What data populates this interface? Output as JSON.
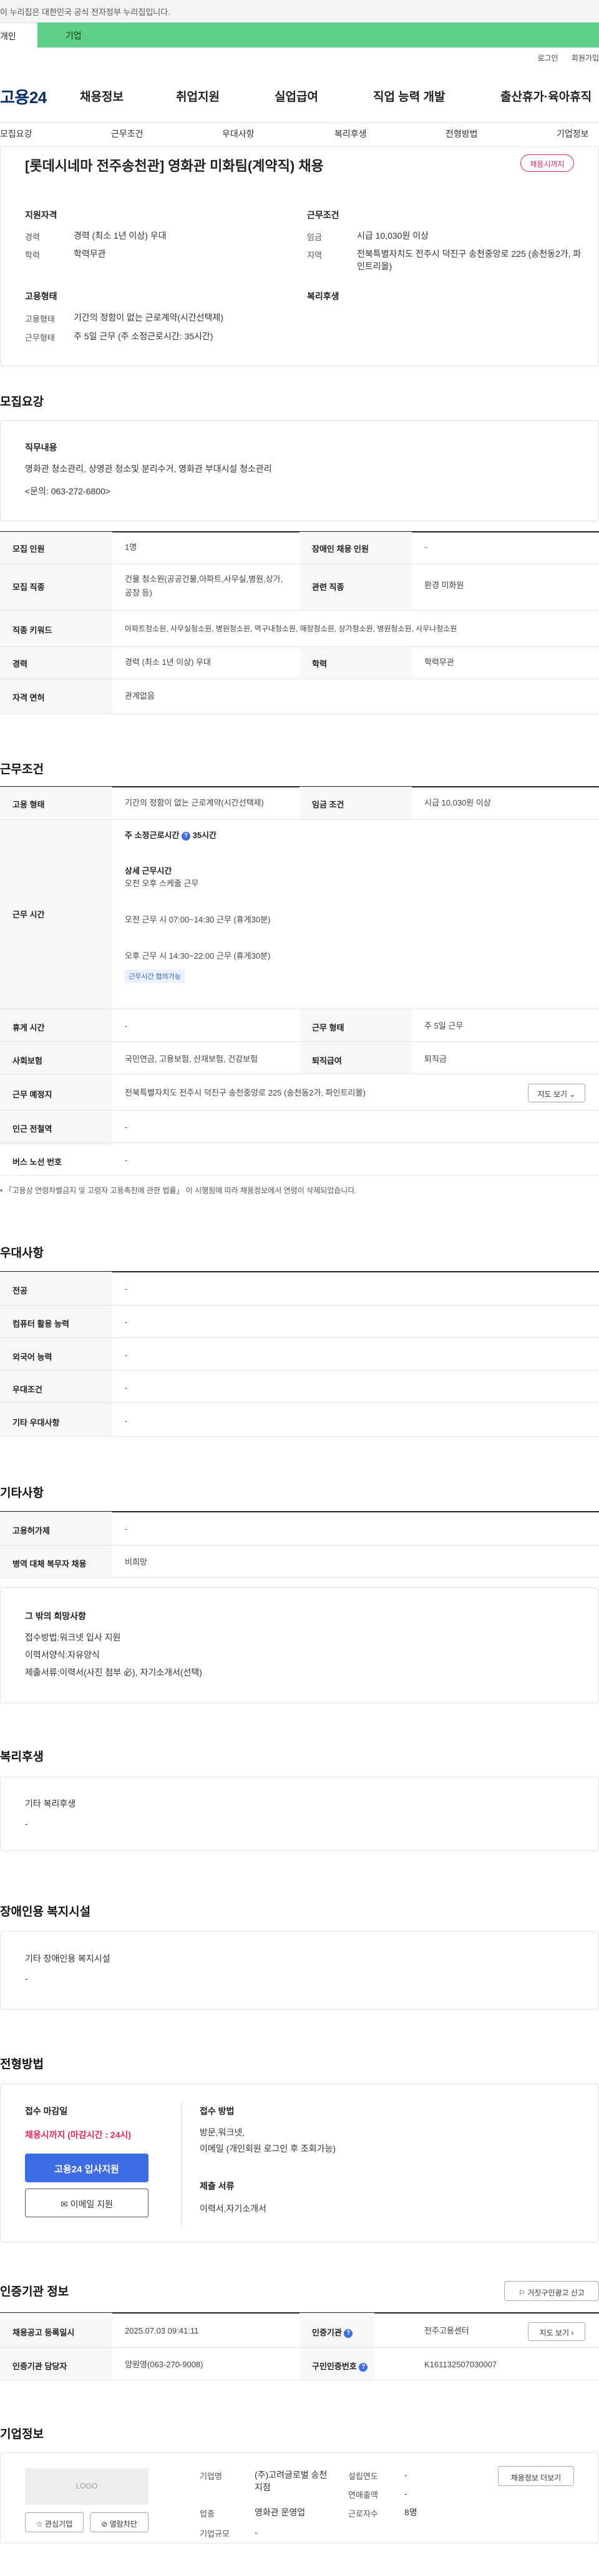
{
  "gov_banner": "이 누리집은 대한민국 공식 전자정부 누리집입니다.",
  "user_tabs": {
    "personal": "개인",
    "company": "기업"
  },
  "utility": {
    "login": "로그인",
    "signup": "회원가입"
  },
  "brand": "고용24",
  "main_nav": [
    "채용정보",
    "취업지원",
    "실업급여",
    "직업 능력 개발",
    "출산휴가·육아휴직"
  ],
  "sub_nav": [
    "모집요강",
    "근무조건",
    "우대사항",
    "복리후생",
    "전형방법",
    "기업정보"
  ],
  "job": {
    "title": "[롯데시네마 전주송천관] 영화관 미화팀(계약직) 채용",
    "badge": "채용시까지",
    "qual_heading": "지원자격",
    "career_label": "경력",
    "career_value": "경력 (최소 1년 이상) 우대",
    "edu_label": "학력",
    "edu_value": "학력무관",
    "work_cond_heading": "근무조건",
    "wage_label": "임금",
    "wage_value": "시급 10,030원 이상",
    "region_label": "지역",
    "region_value": "전북특별자치도 전주시 덕진구 송천중앙로 225 (송천동2가, 파인트리몰)",
    "emp_heading": "고용형태",
    "emp_type_label": "고용형태",
    "emp_type_value": "기간의 정함이 없는 근로계약(시간선택제)",
    "work_type_label": "근무형태",
    "work_type_value": "주 5일 근무 (주 소정근로시간: 35시간)",
    "welfare_heading": "복리후생"
  },
  "recruit": {
    "title": "모집요강",
    "duty_heading": "직무내용",
    "duty_lines": [
      "영화관 청소관리, 상영관 청소및 분리수거, 영화관 부대시설 청소관리",
      "<문의: 063-272-6800>"
    ],
    "rows": {
      "headcount_label": "모집 인원",
      "headcount": "1명",
      "disabled_label": "장애인 채용 인원",
      "disabled": "-",
      "job_label": "모집 직종",
      "job": "건물 청소원(공공건물,아파트,사무실,병원,상가,공장 등)",
      "related_label": "관련 직종",
      "related": "환경 미화원",
      "keyword_label": "직종 키워드",
      "keyword": "아파트청소원, 사무실청소원, 병원청소원, 역구내청소원, 매장청소원, 상가청소원, 병원청소원, 사우나청소원",
      "career_label": "경력",
      "career": "경력 (최소 1년 이상) 우대",
      "edu_label": "학력",
      "edu": "학력무관",
      "license_label": "자격 면허",
      "license": "관계없음"
    }
  },
  "conditions": {
    "title": "근무조건",
    "emp_label": "고용 형태",
    "emp": "기간의 정함이 없는 근로계약(시간선택제)",
    "wage_label": "임금 조건",
    "wage": "시급 10,030원 이상",
    "hours_label": "근무 시간",
    "hours_week": "주 소정근로시간",
    "hours_week_value": "35시간",
    "detail_heading": "상세 근무시간",
    "detail_lines": [
      "오전 오후 스케줄 근무",
      "",
      "오전 근무 시 07:00~14:30 근무 (휴게30분)",
      "",
      "오후 근무 시 14:30~22:00 근무 (휴게30분)"
    ],
    "chip": "근무시간 협의가능",
    "break_label": "휴게 시간",
    "break": "-",
    "shape_label": "근무 형태",
    "shape": "주 5일 근무",
    "insurance_label": "사회보험",
    "insurance": "국민연금, 고용보험, 산재보험, 건강보험",
    "retire_label": "퇴직급여",
    "retire": "퇴직금",
    "place_label": "근무 예정지",
    "place": "전북특별자치도 전주시 덕진구 송천중앙로 225 (송천동2가, 파인트리몰)",
    "map_btn": "지도 보기",
    "station_label": "인근 전철역",
    "station": "-",
    "bus_label": "버스 노선 번호",
    "bus": "-",
    "footnote": "「고용상 연령차별금지 및 고령자 고용촉진에 관한 법률」 이 시행됨에 따라 채용정보에서 연령이 삭제되었습니다."
  },
  "preferred": {
    "title": "우대사항",
    "rows": [
      {
        "label": "전공",
        "value": "-"
      },
      {
        "label": "컴퓨터 활용 능력",
        "value": "-"
      },
      {
        "label": "외국어 능력",
        "value": "-"
      },
      {
        "label": "우대조건",
        "value": "-"
      },
      {
        "label": "기타 우대사항",
        "value": "-"
      }
    ]
  },
  "etc": {
    "title": "기타사항",
    "rows": [
      {
        "label": "고용허가제",
        "value": "-"
      },
      {
        "label": "병역 대체 복무자 채용",
        "value": "비희망"
      }
    ],
    "other_heading": "그 밖의 희망사항",
    "other_lines": [
      "접수방법:워크넷 입사 지원",
      "이력서양식:자유양식",
      "제출서류:이력서(사진 첨부 必), 자기소개서(선택)"
    ]
  },
  "welfare": {
    "title": "복리후생",
    "heading": "기타 복리후생",
    "value": "-"
  },
  "disability": {
    "title": "장애인용 복지시설",
    "heading": "기타 장애인용 복지시설",
    "value": "-"
  },
  "selection": {
    "title": "전형방법",
    "deadline_heading": "접수 마감일",
    "deadline_value": "채용시까지 (마감시간 : 24시)",
    "apply_btn": "고용24 입사지원",
    "email_btn": "이메일 지원",
    "method_heading": "접수 방법",
    "method_lines": [
      "방문,워크넷,",
      "이메일 (개인회원 로그인 후 조회가능)"
    ],
    "docs_heading": "제출 서류",
    "docs_value": "이력서,자기소개서"
  },
  "agency": {
    "title": "인증기관 정보",
    "report_btn": "거짓구인광고 신고",
    "reg_label": "채용공고 등록일시",
    "reg": "2025.07.03 09:41:11",
    "org_label": "인증기관",
    "org": "전주고용센터",
    "map_btn": "지도 보기",
    "manager_label": "인증기관 담당자",
    "manager": "양원영(063-270-9008)",
    "no_label": "구인인증번호",
    "no": "K161132507030007"
  },
  "company": {
    "title": "기업정보",
    "logo": "LOGO",
    "interest_btn": "관심기업",
    "block_btn": "열람차단",
    "name_label": "기업명",
    "name": "(주)고려글로벌 송천지점",
    "industry_label": "업종",
    "industry": "영화관 운영업",
    "size_label": "기업규모",
    "size": "-",
    "founded_label": "설립연도",
    "founded": "-",
    "sales_label": "연매출액",
    "sales": "-",
    "staff_label": "근로자수",
    "staff": "8명",
    "jobs_btn": "채용정보 더보기"
  }
}
